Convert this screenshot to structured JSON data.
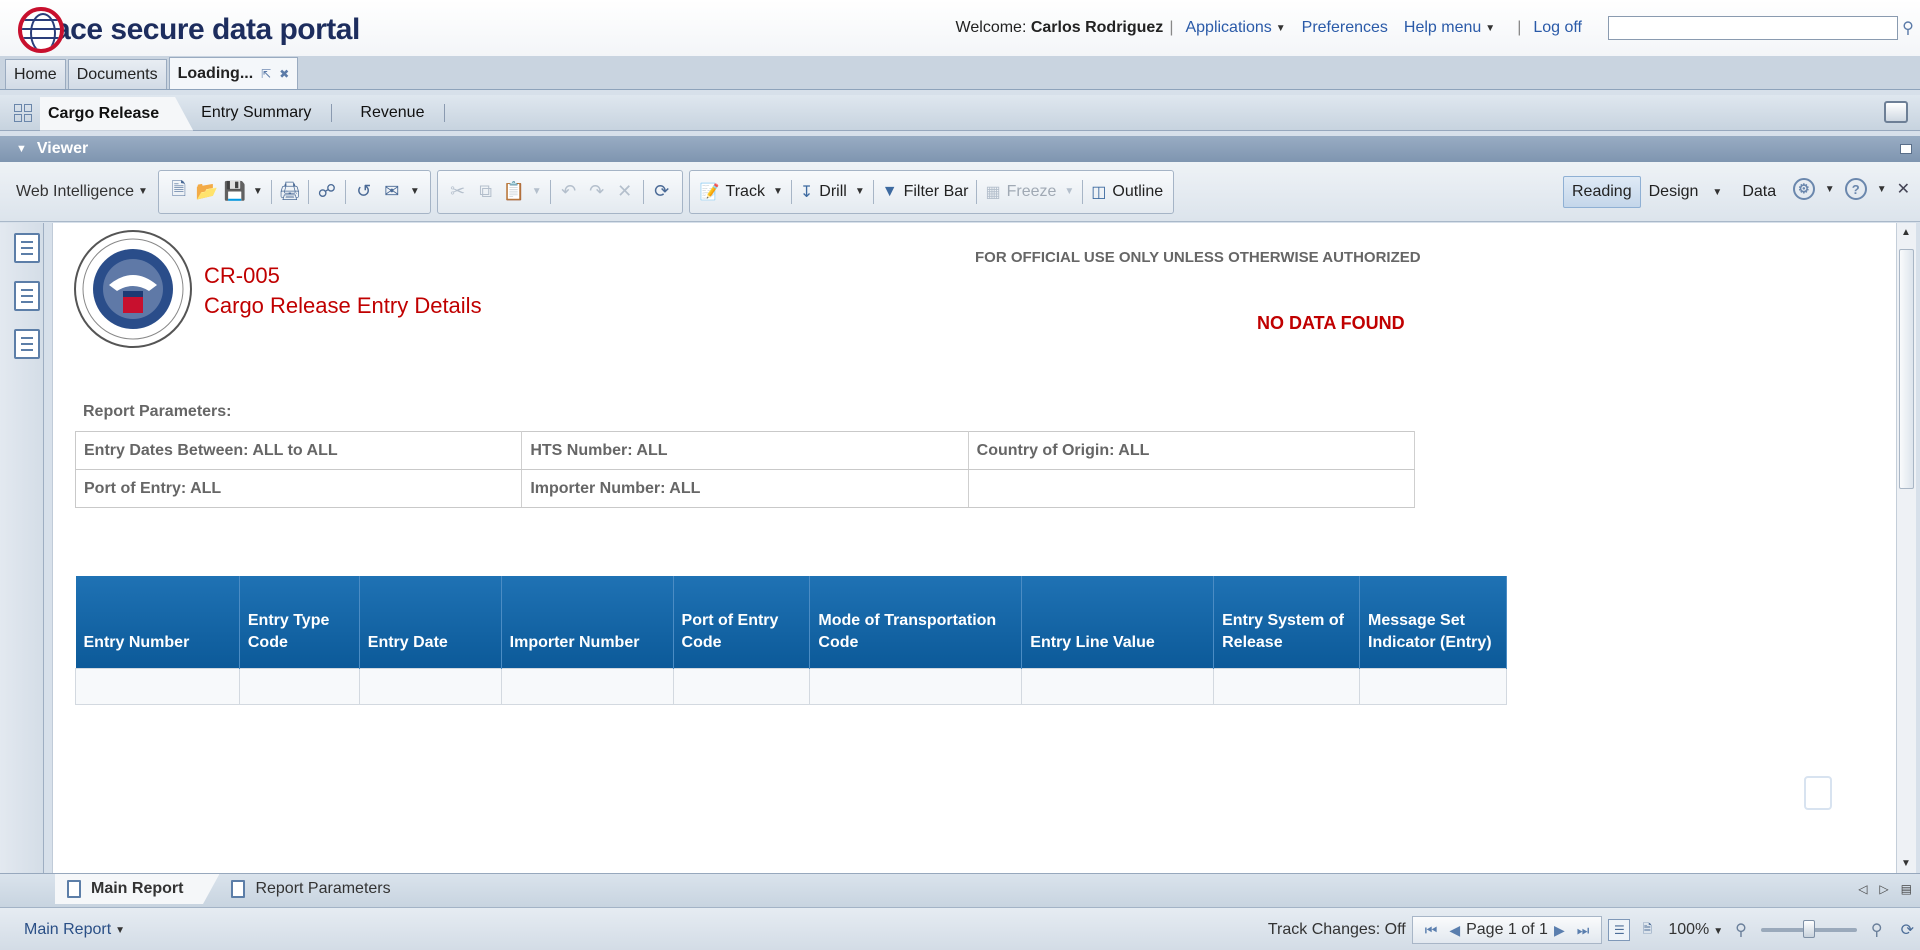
{
  "header": {
    "logo_text": "ace secure data portal",
    "welcome_prefix": "Welcome:",
    "user_name": "Carlos Rodriguez",
    "links": {
      "applications": "Applications",
      "preferences": "Preferences",
      "help_menu": "Help menu",
      "log_off": "Log off"
    },
    "search_value": ""
  },
  "doc_tabs": {
    "home": "Home",
    "documents": "Documents",
    "loading": "Loading..."
  },
  "report_tabs": {
    "cargo_release": "Cargo Release",
    "entry_summary": "Entry Summary",
    "revenue": "Revenue"
  },
  "viewer": {
    "title": "Viewer"
  },
  "toolbar": {
    "web_intelligence": "Web Intelligence",
    "track": "Track",
    "drill": "Drill",
    "filter_bar": "Filter Bar",
    "freeze": "Freeze",
    "outline": "Outline",
    "modes": {
      "reading": "Reading",
      "design": "Design",
      "data": "Data"
    }
  },
  "report": {
    "code": "CR-005",
    "title": "Cargo Release Entry Details",
    "fouo": "FOR OFFICIAL USE ONLY UNLESS OTHERWISE AUTHORIZED",
    "no_data": "NO DATA FOUND",
    "params_label": "Report Parameters:",
    "params": {
      "entry_dates": "Entry Dates Between:  ALL to ALL",
      "hts_number": "HTS Number:  ALL",
      "country_of_origin": "Country of Origin:  ALL",
      "port_of_entry": "Port of Entry:  ALL",
      "importer_number": "Importer Number:  ALL"
    },
    "columns": [
      "Entry Number",
      "Entry Type Code",
      "Entry Date",
      "Importer Number",
      "Port of Entry Code",
      "Mode of Transportation Code",
      "Entry Line Value",
      "Entry System of Release",
      "Message Set Indicator (Entry)"
    ],
    "seal_text": "U.S. DEPARTMENT OF HOMELAND SECURITY"
  },
  "bottom_tabs": {
    "main_report": "Main Report",
    "report_parameters": "Report Parameters"
  },
  "status": {
    "main_report": "Main Report",
    "track_changes": "Track Changes: Off",
    "page": "Page 1 of 1",
    "zoom": "100%"
  }
}
